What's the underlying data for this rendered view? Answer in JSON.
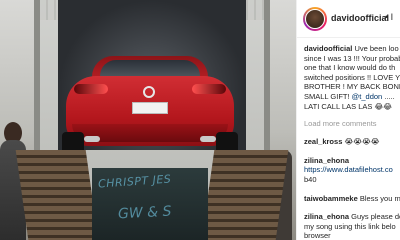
{
  "photo": {
    "crate_text_line1": "CHRISPT JES",
    "crate_text_line2": "GW &amp; S"
  },
  "post": {
    "username": "davidoofficial",
    "more_glyph": "• I"
  },
  "caption": {
    "username": "davidoofficial",
    "lines": [
      "Uve been loo",
      "since I was 13 !!! Your probab",
      "one that I know would do th",
      "switched positions !! LOVE Y",
      "BROTHER ! MY BACK BONE!",
      "SMALL GIFT!"
    ],
    "mention": "@t_ddon",
    "mention_suffix": ".....",
    "last_line": "LATI CALL LAS LAS 😂😂"
  },
  "load_more_label": "Load more comments",
  "comments": [
    {
      "user": "zeal_kross",
      "lines": [
        "😭😭😭😭"
      ]
    },
    {
      "user": "zilina_ehona",
      "lines": [
        "https://www.datafilehost.co",
        "b40"
      ]
    },
    {
      "user": "taiwobammeke",
      "lines": [
        "Bless you m"
      ]
    },
    {
      "user": "zilina_ehona",
      "lines": [
        "Guys please do",
        "my song using this link belo",
        "browser"
      ]
    }
  ]
}
